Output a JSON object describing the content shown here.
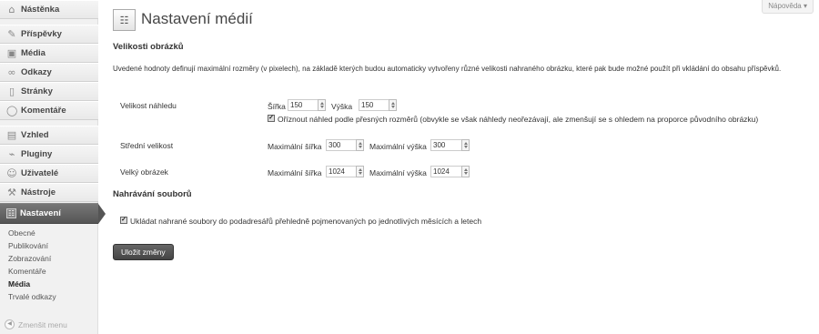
{
  "sidebar": {
    "items": [
      {
        "label": "Nástěnka",
        "icon": "home-icon"
      },
      {
        "label": "Příspěvky",
        "icon": "pin-icon"
      },
      {
        "label": "Média",
        "icon": "media-icon"
      },
      {
        "label": "Odkazy",
        "icon": "link-icon"
      },
      {
        "label": "Stránky",
        "icon": "page-icon"
      },
      {
        "label": "Komentáře",
        "icon": "comment-icon"
      },
      {
        "label": "Vzhled",
        "icon": "appearance-icon"
      },
      {
        "label": "Pluginy",
        "icon": "plugin-icon"
      },
      {
        "label": "Uživatelé",
        "icon": "users-icon"
      },
      {
        "label": "Nástroje",
        "icon": "tools-icon"
      },
      {
        "label": "Nastavení",
        "icon": "settings-icon"
      }
    ],
    "submenu": [
      "Obecné",
      "Publikování",
      "Zobrazování",
      "Komentáře",
      "Média",
      "Trvalé odkazy"
    ],
    "collapse_label": "Zmenšit menu"
  },
  "header": {
    "title": "Nastavení médií",
    "help_label": "Nápověda"
  },
  "sizes": {
    "heading": "Velikosti obrázků",
    "description": "Uvedené hodnoty definují maximální rozměry (v pixelech), na základě kterých budou automaticky vytvořeny různé velikosti nahraného obrázku, které pak bude možné použít při vkládání do obsahu příspěvků.",
    "thumb": {
      "label": "Velikost náhledu",
      "width_label": "Šířka",
      "width": "150",
      "height_label": "Výška",
      "height": "150",
      "crop_label": "Oříznout náhled podle přesných rozměrů (obvykle se však náhledy neořezávají, ale zmenšují se s ohledem na proporce původního obrázku)",
      "crop_checked": true
    },
    "medium": {
      "label": "Střední velikost",
      "width_label": "Maximální šířka",
      "width": "300",
      "height_label": "Maximální výška",
      "height": "300"
    },
    "large": {
      "label": "Velký obrázek",
      "width_label": "Maximální šířka",
      "width": "1024",
      "height_label": "Maximální výška",
      "height": "1024"
    }
  },
  "uploads": {
    "heading": "Nahrávání souborů",
    "folders_label": "Ukládat nahrané soubory do podadresářů přehledně pojmenovaných po jednotlivých měsících a letech",
    "folders_checked": true
  },
  "save_label": "Uložit změny"
}
